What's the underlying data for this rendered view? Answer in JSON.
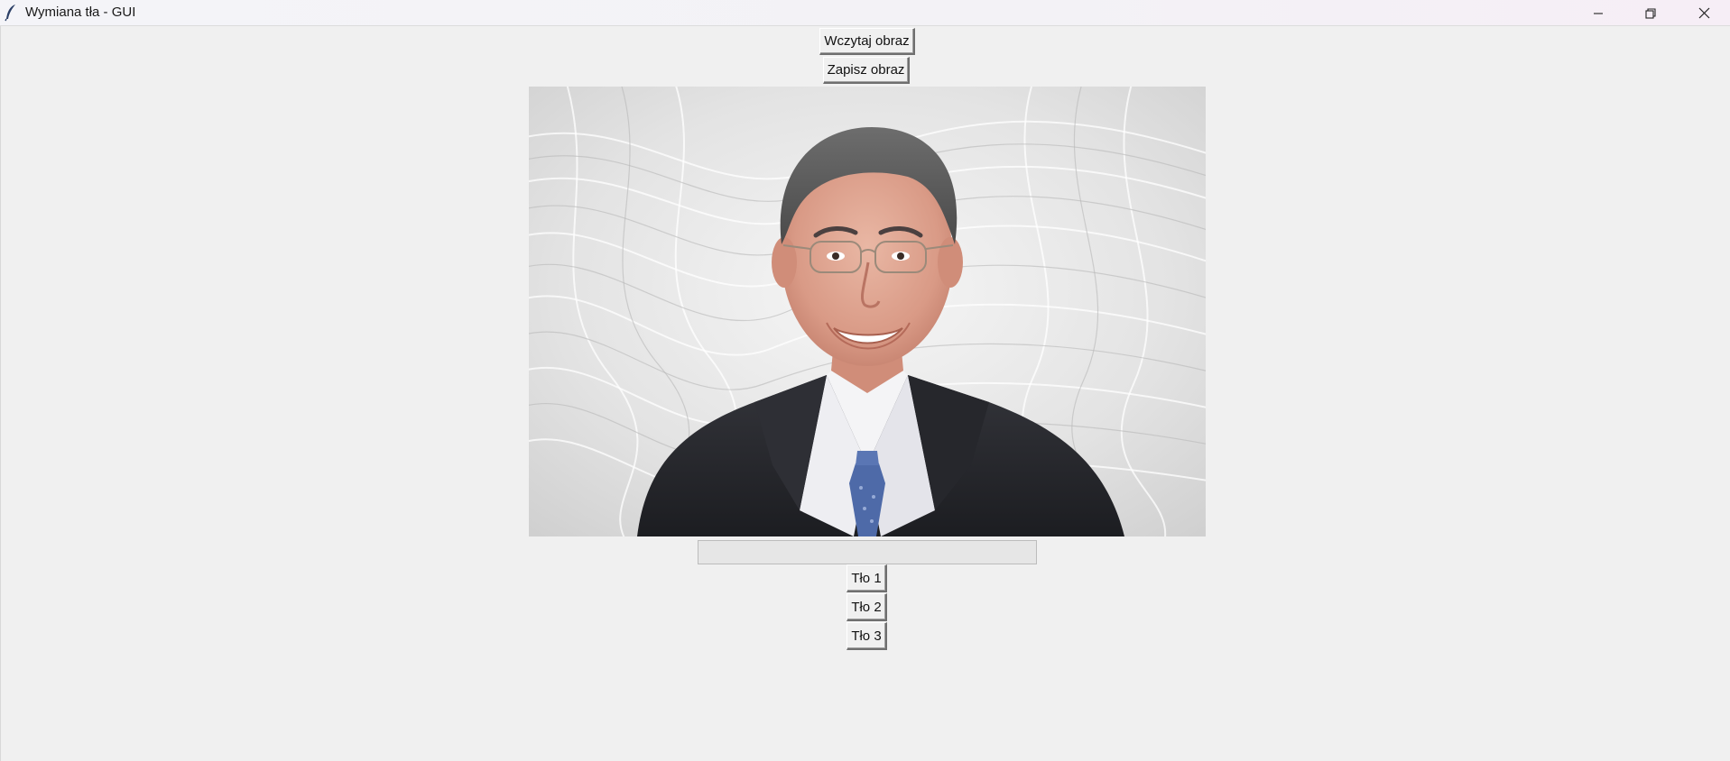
{
  "window": {
    "title": "Wymiana tła - GUI",
    "icon": "feather-icon",
    "controls": [
      "minimize-icon",
      "restore-icon",
      "close-icon"
    ]
  },
  "toolbar": {
    "load_label": "Wczytaj obraz",
    "save_label": "Zapisz obraz"
  },
  "image": {
    "subject": "portrait",
    "background": "white-swirl"
  },
  "progress": {
    "value": 0
  },
  "backgrounds": [
    {
      "label": "Tło 1"
    },
    {
      "label": "Tło 2"
    },
    {
      "label": "Tło 3"
    }
  ],
  "colors": {
    "window_bg": "#f0f0f0",
    "suit": "#2a2b30",
    "tie": "#4e6aa8"
  }
}
